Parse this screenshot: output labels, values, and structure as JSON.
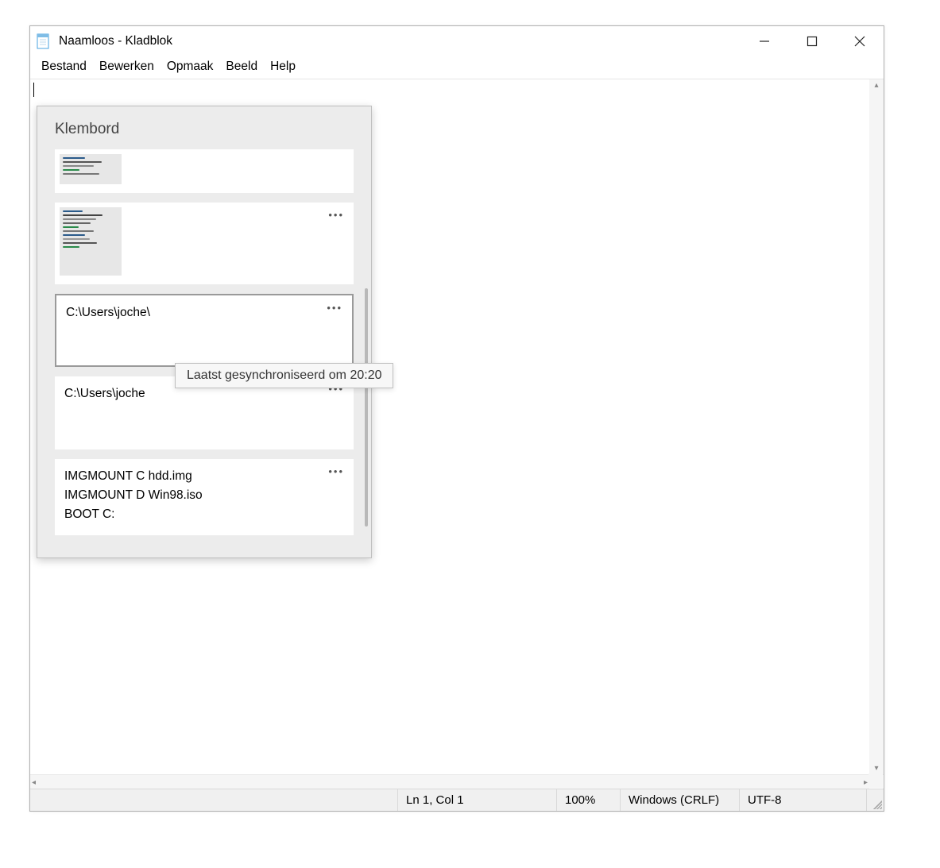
{
  "window": {
    "title": "Naamloos - Kladblok"
  },
  "menu": {
    "items": [
      "Bestand",
      "Bewerken",
      "Opmaak",
      "Beeld",
      "Help"
    ]
  },
  "status": {
    "position": "Ln 1, Col 1",
    "zoom": "100%",
    "eol": "Windows (CRLF)",
    "encoding": "UTF-8"
  },
  "clipboard": {
    "title": "Klembord",
    "tooltip": "Laatst gesynchroniseerd om 20:20",
    "ellipsis": "•••",
    "items": [
      {
        "type": "image"
      },
      {
        "type": "image"
      },
      {
        "type": "text",
        "content": "C:\\Users\\joche\\",
        "selected": true
      },
      {
        "type": "text",
        "content": "C:\\Users\\joche"
      },
      {
        "type": "text",
        "content": "IMGMOUNT C hdd.img\nIMGMOUNT D Win98.iso\nBOOT C:"
      }
    ]
  }
}
